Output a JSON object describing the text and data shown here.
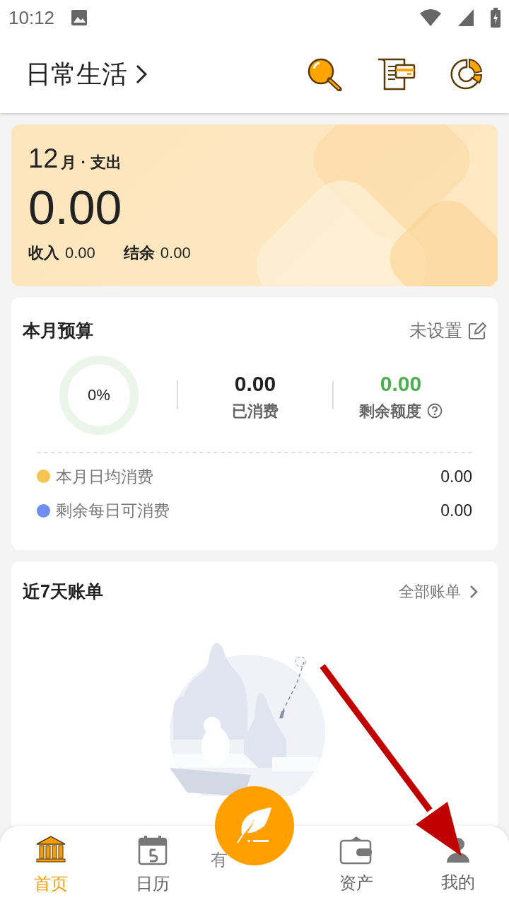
{
  "status_bar": {
    "time": "10:12"
  },
  "header": {
    "title": "日常生活"
  },
  "summary": {
    "month": "12",
    "label": "月 · 支出",
    "amount": "0.00",
    "income_label": "收入",
    "income": "0.00",
    "balance_label": "结余",
    "balance": "0.00"
  },
  "budget": {
    "title": "本月预算",
    "status": "未设置",
    "percent": "0%",
    "level": 0,
    "spent": "0.00",
    "spent_label": "已消费",
    "remaining": "0.00",
    "remaining_label": "剩余额度",
    "rows": [
      {
        "label": "本月日均消费",
        "value": "0.00",
        "color": "#f5c451"
      },
      {
        "label": "剩余每日可消费",
        "value": "0.00",
        "color": "#6f8ff0"
      }
    ]
  },
  "bills": {
    "title": "近7天账单",
    "link": "全部账单",
    "empty_left": "有"
  },
  "nav": [
    {
      "label": "首页",
      "kind": "home",
      "selected": true
    },
    {
      "label": "日历",
      "kind": "calendar",
      "selected": false
    },
    {
      "label": "资产",
      "kind": "wallet",
      "selected": false
    },
    {
      "label": "我的",
      "kind": "profile",
      "selected": false
    }
  ]
}
